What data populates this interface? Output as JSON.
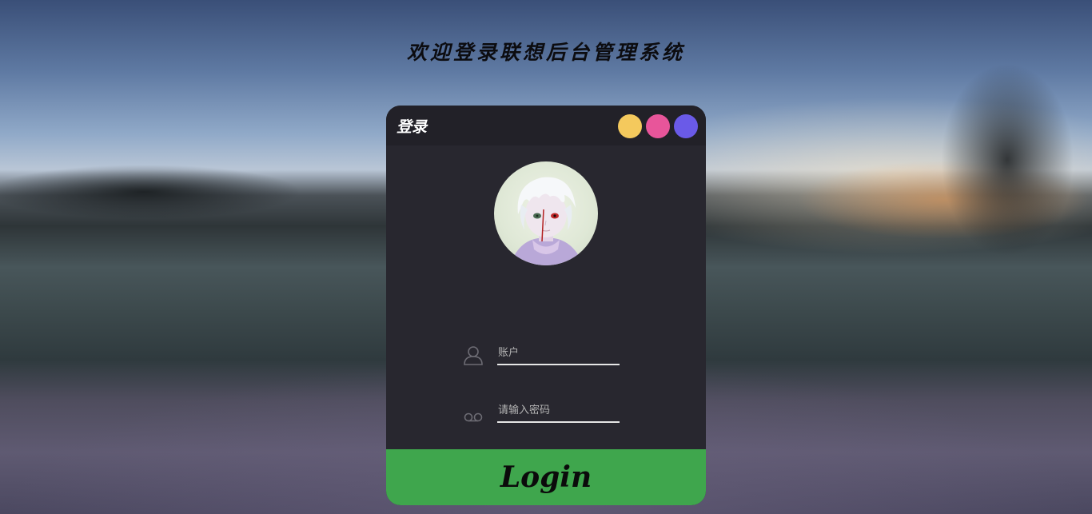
{
  "page": {
    "title": "欢迎登录联想后台管理系统"
  },
  "card": {
    "header_title": "登录",
    "window_dots": [
      {
        "name": "yellow",
        "color": "#f4c95d"
      },
      {
        "name": "pink",
        "color": "#e8559a"
      },
      {
        "name": "purple",
        "color": "#6a5ae8"
      }
    ],
    "avatar": {
      "icon": "avatar-image"
    },
    "account": {
      "placeholder": "账户",
      "value": "",
      "icon": "user-icon"
    },
    "password": {
      "placeholder": "请输入密码",
      "value": "",
      "icon": "voicemail-icon"
    },
    "login_label": "Login"
  },
  "colors": {
    "card_bg": "#28272f",
    "header_bg": "#222128",
    "login_green": "#3fa64d"
  }
}
